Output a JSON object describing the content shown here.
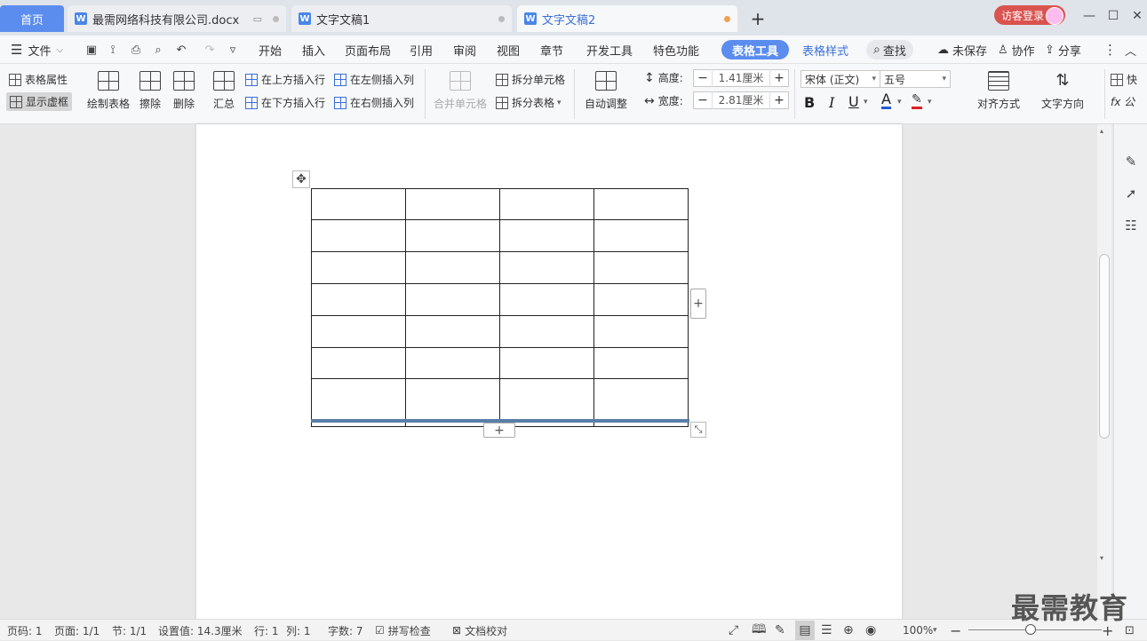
{
  "tabs": {
    "home": "首页",
    "docs": [
      {
        "label": "最需网络科技有限公司.docx"
      },
      {
        "label": "文字文稿1"
      },
      {
        "label": "文字文稿2"
      }
    ],
    "new_tab": "+"
  },
  "account": {
    "login": "访客登录"
  },
  "window": {
    "minimize": "—",
    "maximize": "☐",
    "close": "✕"
  },
  "menu": {
    "file": "文件",
    "items": [
      "开始",
      "插入",
      "页面布局",
      "引用",
      "审阅",
      "视图",
      "章节",
      "开发工具",
      "特色功能"
    ],
    "table_tools": "表格工具",
    "table_style": "表格样式",
    "search": "查找",
    "unsaved": "未保存",
    "collab": "协作",
    "share": "分享"
  },
  "ribbon": {
    "table_props": "表格属性",
    "show_grid": "显示虚框",
    "draw_table": "绘制表格",
    "erase": "擦除",
    "delete": "删除",
    "summary": "汇总",
    "insert_above": "在上方插入行",
    "insert_below": "在下方插入行",
    "insert_left": "在左侧插入列",
    "insert_right": "在右侧插入列",
    "merge_cells": "合并单元格",
    "split_cells": "拆分单元格",
    "split_table": "拆分表格",
    "auto_fit": "自动调整",
    "height_label": "高度:",
    "height_value": "1.41厘米",
    "width_label": "宽度:",
    "width_value": "2.81厘米",
    "font_name": "宋体 (正文)",
    "font_size": "五号",
    "bold": "B",
    "italic": "I",
    "underline": "U",
    "font_color": "A",
    "align": "对齐方式",
    "text_dir": "文字方向",
    "quick": "快",
    "formula": "fx 公"
  },
  "document": {
    "table": {
      "rows": 7,
      "cols": 4
    }
  },
  "status": {
    "page": "页码: 1",
    "pages": "页面: 1/1",
    "section": "节: 1/1",
    "setting": "设置值: 14.3厘米",
    "row": "行: 1",
    "col": "列: 1",
    "words": "字数: 7",
    "spell": "拼写检查",
    "proof": "文档校对",
    "zoom": "100%"
  },
  "watermark": "最需教育",
  "colors": {
    "accent": "#5b8def",
    "login": "#d9534f"
  }
}
